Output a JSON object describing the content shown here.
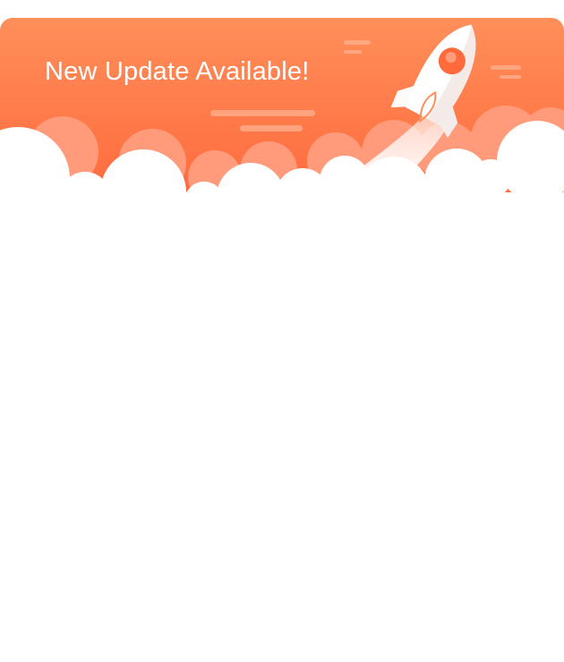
{
  "dialog": {
    "title": "New Update Available!",
    "header_icon": "rocket-icon",
    "colors": {
      "header_top": "#FF8F5A",
      "header_bottom": "#FF6A3D",
      "cloud_back": "#FF9B7A",
      "cloud_front": "#FFFFFF",
      "body": "#FFFFFF"
    }
  }
}
